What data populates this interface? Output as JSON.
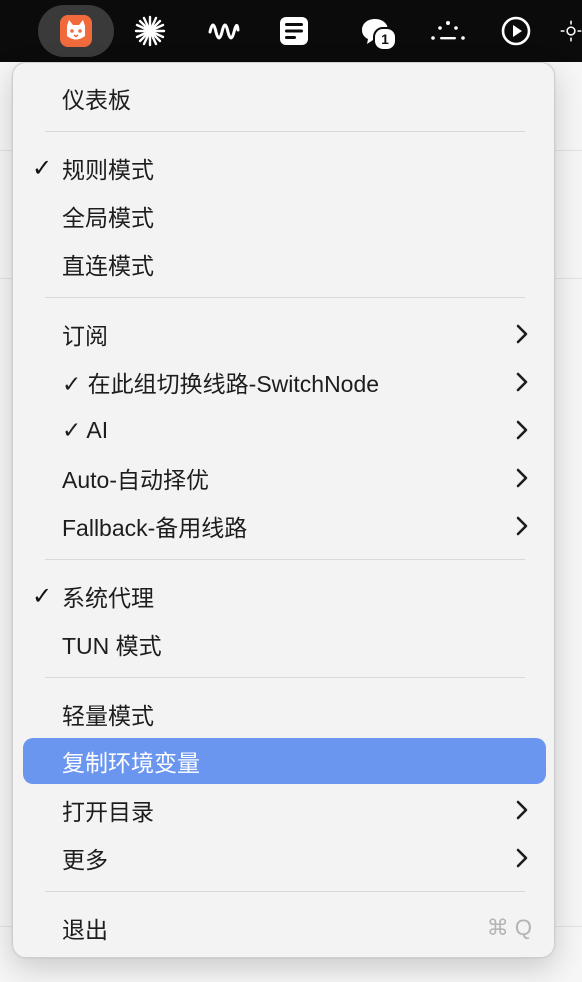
{
  "colors": {
    "menubar_bg": "#0b0b0b",
    "menu_bg": "#f3f3f3",
    "highlight": "#6b96f0",
    "app_icon_orange": "#f06a3c",
    "shortcut_text": "#b4b4b4"
  },
  "menubar": {
    "icons": [
      {
        "icon": "clash-cat-app-icon",
        "active": true
      },
      {
        "icon": "asterisk-burst-icon",
        "active": false
      },
      {
        "icon": "waveform-icon",
        "active": false
      },
      {
        "icon": "notes-icon",
        "active": false
      },
      {
        "icon": "chat-cloud-icon",
        "active": false,
        "badge": "1"
      },
      {
        "icon": "dots-arc-icon",
        "active": false
      },
      {
        "icon": "play-circle-icon",
        "active": false
      },
      {
        "icon": "sun-icon",
        "active": false
      }
    ],
    "badge_count": "1"
  },
  "menu": {
    "dashboard": "仪表板",
    "rule_mode": "规则模式",
    "global_mode": "全局模式",
    "direct_mode": "直连模式",
    "subscription": "订阅",
    "switchnode": "✓ 在此组切换线路-SwitchNode",
    "ai": "✓ AI",
    "auto": "Auto-自动择优",
    "fallback": "Fallback-备用线路",
    "system_proxy": "系统代理",
    "tun_mode": "TUN 模式",
    "lite_mode": "轻量模式",
    "copy_env": "复制环境变量",
    "open_dir": "打开目录",
    "more": "更多",
    "quit": "退出",
    "quit_shortcut": "⌘ Q",
    "checkmark": "✓"
  }
}
